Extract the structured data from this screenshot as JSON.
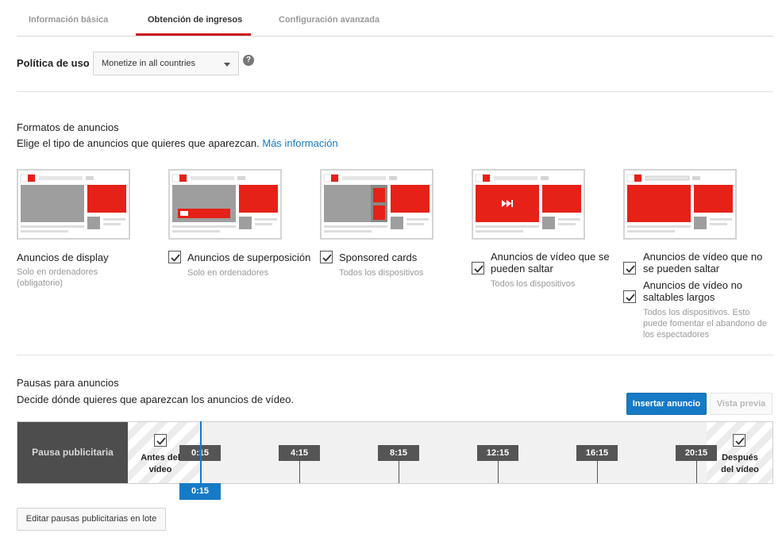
{
  "tabs": [
    {
      "label": "Información básica",
      "active": false
    },
    {
      "label": "Obtención de ingresos",
      "active": true
    },
    {
      "label": "Configuración avanzada",
      "active": false
    }
  ],
  "policy": {
    "label": "Política de uso",
    "selected": "Monetize in all countries",
    "help": "?"
  },
  "formats": {
    "title": "Formatos de anuncios",
    "desc": "Elige el tipo de anuncios que quieres que aparezcan.",
    "more_link": "Más información",
    "items": [
      {
        "label": "Anuncios de display",
        "sub": "Solo en ordenadores (obligatorio)",
        "checkbox": false
      },
      {
        "label": "Anuncios de superposición",
        "sub": "Solo en ordenadores",
        "checked": true
      },
      {
        "label": "Sponsored cards",
        "sub": "Todos los dispositivos",
        "checked": true
      },
      {
        "label": "Anuncios de vídeo que se pueden saltar",
        "sub": "Todos los dispositivos",
        "checked": true
      },
      {
        "label": "Anuncios de vídeo que no se pueden saltar",
        "checked": true
      },
      {
        "label": "Anuncios de vídeo no saltables largos",
        "sub": "Todos los dispositivos. Esto puede fomentar el abandono de los espectadores",
        "checked": true
      }
    ],
    "thumb_logo": "YouTube"
  },
  "breaks": {
    "title": "Pausas para anuncios",
    "desc": "Decide dónde quieres que aparezcan los anuncios de vídeo.",
    "insert_button": "Insertar anuncio",
    "preview_button": "Vista previa",
    "timeline_label": "Pausa publicitaria",
    "before_label_1": "Antes del",
    "before_label_2": "vídeo",
    "after_label_1": "Después",
    "after_label_2": "del vídeo",
    "before_checked": true,
    "after_checked": true,
    "markers": [
      "0:15",
      "4:15",
      "8:15",
      "12:15",
      "16:15",
      "20:15"
    ],
    "playhead_time": "0:15",
    "batch_button": "Editar pausas publicitarias en lote"
  },
  "colors": {
    "accent_red": "#cc181e",
    "link_blue": "#167ac6",
    "ad_red": "#e62117"
  }
}
